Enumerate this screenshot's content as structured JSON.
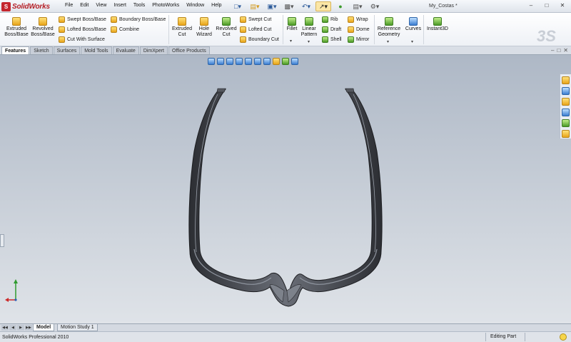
{
  "app": {
    "name": "SolidWorks",
    "doc_title": "My_Costas *"
  },
  "menu": [
    "File",
    "Edit",
    "View",
    "Insert",
    "Tools",
    "PhotoWorks",
    "Window",
    "Help"
  ],
  "quick_access": [
    "new-doc",
    "open",
    "save",
    "print",
    "undo",
    "select",
    "rebuild",
    "file-properties",
    "options"
  ],
  "window_controls": {
    "minimize": "–",
    "restore": "□",
    "close": "✕"
  },
  "ribbon": {
    "extruded_boss": "Extruded\nBoss/Base",
    "revolved_boss": "Revolved\nBoss/Base",
    "swept_boss": "Swept Boss/Base",
    "lofted_boss": "Lofted Boss/Base",
    "cut_with_surface": "Cut With Surface",
    "boundary_boss": "Boundary Boss/Base",
    "combine": "Combine",
    "extruded_cut": "Extruded\nCut",
    "hole_wizard": "Hole\nWizard",
    "revolved_cut": "Revolved\nCut",
    "swept_cut": "Swept Cut",
    "lofted_cut": "Lofted Cut",
    "boundary_cut": "Boundary Cut",
    "fillet": "Fillet",
    "linear_pattern": "Linear\nPattern",
    "rib": "Rib",
    "draft": "Draft",
    "shell": "Shell",
    "wrap": "Wrap",
    "dome": "Dome",
    "mirror": "Mirror",
    "reference_geometry": "Reference\nGeometry",
    "curves": "Curves",
    "instant3d": "Instant3D"
  },
  "tabs": [
    {
      "label": "Features",
      "active": true
    },
    {
      "label": "Sketch",
      "active": false
    },
    {
      "label": "Surfaces",
      "active": false
    },
    {
      "label": "Mold Tools",
      "active": false
    },
    {
      "label": "Evaluate",
      "active": false
    },
    {
      "label": "DimXpert",
      "active": false
    },
    {
      "label": "Office Products",
      "active": false
    }
  ],
  "bottom_tabs": [
    {
      "label": "Model",
      "active": true
    },
    {
      "label": "Motion Study 1",
      "active": false
    }
  ],
  "nav_arrows": [
    "◀◀",
    "◀",
    "▶",
    "▶▶"
  ],
  "status": {
    "left": "SolidWorks Professional 2010",
    "mode": "Editing Part"
  },
  "colors": {
    "accent": "#c4262e",
    "viewport_top": "#aeb8c6",
    "viewport_bottom": "#dfe3e8",
    "model": "#4a4d54"
  }
}
